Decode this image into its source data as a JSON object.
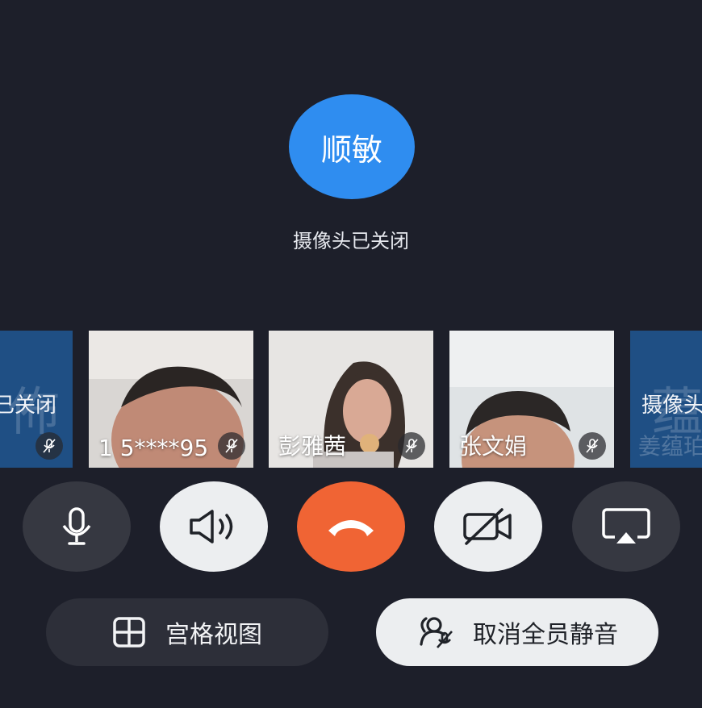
{
  "speaker": {
    "avatar_text": "顺敏",
    "camera_status": "摄像头已关闭"
  },
  "tiles": [
    {
      "big_char": "佈",
      "status_text": "已关闭",
      "name": ""
    },
    {
      "name": "1 5****95"
    },
    {
      "name": "彭雅茜"
    },
    {
      "name": "张文娟"
    },
    {
      "big_char": "蕴",
      "status_text": "摄像头",
      "name": "姜蕴珀"
    }
  ],
  "controls": {
    "mic": "microphone-icon",
    "speaker": "speaker-icon",
    "hangup": "hang-up-icon",
    "camera": "camera-off-icon",
    "share": "screen-share-icon"
  },
  "bottom_buttons": {
    "grid_view_label": "宫格视图",
    "unmute_all_label": "取消全员静音"
  },
  "colors": {
    "background": "#1d1f2a",
    "avatar": "#2f8df0",
    "hangup": "#f06434",
    "tile_blue": "#1f4f84"
  }
}
